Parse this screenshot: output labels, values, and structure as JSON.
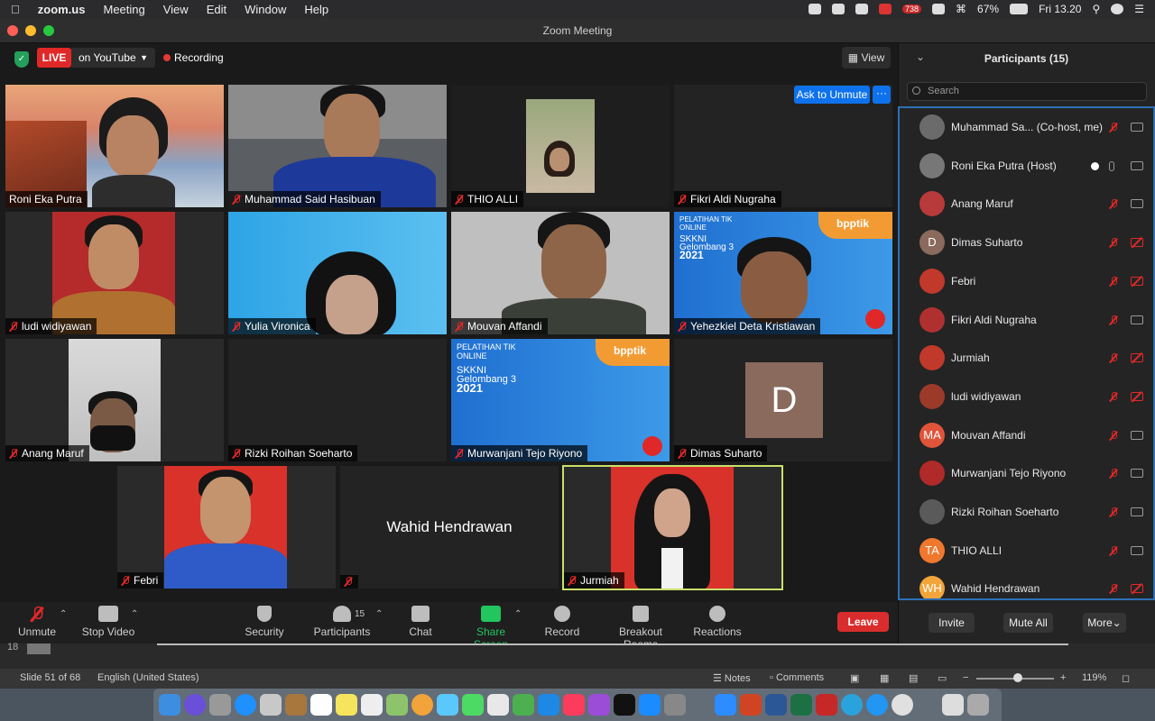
{
  "menubar": {
    "items": [
      "zoom.us",
      "Meeting",
      "View",
      "Edit",
      "Window",
      "Help"
    ],
    "battery": "67%",
    "clock": "Fri 13.20",
    "badge": "738"
  },
  "window": {
    "title": "Zoom Meeting"
  },
  "topbar": {
    "live": "LIVE",
    "stream": "on YouTube",
    "recording": "Recording",
    "view": "View",
    "ask_to_unmute": "Ask to Unmute",
    "more": "···"
  },
  "tiles": [
    {
      "name": "Roni Eka Putra",
      "muted": false
    },
    {
      "name": "Muhammad Said Hasibuan",
      "muted": true
    },
    {
      "name": "THIO ALLI",
      "muted": true
    },
    {
      "name": "Fikri Aldi Nugraha",
      "muted": true
    },
    {
      "name": "ludi widiyawan",
      "muted": true
    },
    {
      "name": "Yulia Vironica",
      "muted": true
    },
    {
      "name": "Mouvan Affandi",
      "muted": true
    },
    {
      "name": "Yehezkiel Deta Kristiawan",
      "muted": true
    },
    {
      "name": "Anang Maruf",
      "muted": true
    },
    {
      "name": "Rizki Roihan Soeharto",
      "muted": true
    },
    {
      "name": "Murwanjani Tejo Riyono",
      "muted": true
    },
    {
      "name": "Dimas Suharto",
      "muted": true,
      "initial": "D"
    },
    {
      "name": "Febri",
      "muted": true
    },
    {
      "name": "",
      "muted": true,
      "center_name": "Wahid Hendrawan"
    },
    {
      "name": "Jurmiah",
      "muted": true
    }
  ],
  "banner": {
    "line1": "PELATIHAN TIK",
    "line2": "ONLINE",
    "line3": "SKKNI",
    "line4": "Gelombang 3",
    "line5": "2021",
    "brand": "bpptik"
  },
  "toolbar": {
    "unmute": "Unmute",
    "stop_video": "Stop Video",
    "security": "Security",
    "participants": "Participants",
    "participants_count": "15",
    "chat": "Chat",
    "share_screen": "Share Screen",
    "record": "Record",
    "breakout": "Breakout Rooms",
    "reactions": "Reactions",
    "leave": "Leave"
  },
  "panel": {
    "title": "Participants (15)",
    "search_placeholder": "Search",
    "participants": [
      {
        "name": "Muhammad Sa... (Co-host, me)",
        "initials": "",
        "color": "#6b6b6b",
        "cam_off": false
      },
      {
        "name": "Roni Eka Putra (Host)",
        "initials": "",
        "color": "#777777",
        "cam_off": false
      },
      {
        "name": "Anang Maruf",
        "initials": "",
        "color": "#b83a3a",
        "cam_off": false
      },
      {
        "name": "Dimas Suharto",
        "initials": "D",
        "color": "#8a6a5c",
        "cam_off": true
      },
      {
        "name": "Febri",
        "initials": "",
        "color": "#c0392b",
        "cam_off": true
      },
      {
        "name": "Fikri Aldi Nugraha",
        "initials": "",
        "color": "#b03030",
        "cam_off": false
      },
      {
        "name": "Jurmiah",
        "initials": "",
        "color": "#c0392b",
        "cam_off": true
      },
      {
        "name": "ludi widiyawan",
        "initials": "",
        "color": "#9c3a2a",
        "cam_off": true
      },
      {
        "name": "Mouvan Affandi",
        "initials": "MA",
        "color": "#e0553a",
        "cam_off": false
      },
      {
        "name": "Murwanjani Tejo Riyono",
        "initials": "",
        "color": "#b02a2a",
        "cam_off": false
      },
      {
        "name": "Rizki Roihan Soeharto",
        "initials": "",
        "color": "#5a5a5a",
        "cam_off": false
      },
      {
        "name": "THIO ALLI",
        "initials": "TA",
        "color": "#f0772e",
        "cam_off": false
      },
      {
        "name": "Wahid Hendrawan",
        "initials": "WH",
        "color": "#f2a53a",
        "cam_off": true
      }
    ],
    "invite": "Invite",
    "mute_all": "Mute All",
    "more": "More"
  },
  "ppt": {
    "slide_number": "18",
    "slide_status": "Slide 51 of 68",
    "language": "English (United States)",
    "notes": "Notes",
    "comments": "Comments",
    "zoom": "119%",
    "minus": "−",
    "plus": "+"
  }
}
